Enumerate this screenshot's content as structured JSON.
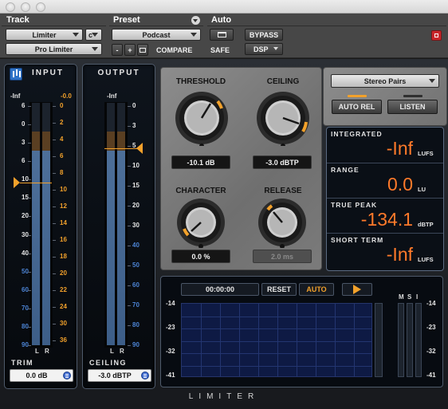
{
  "header": {
    "track_label": "Track",
    "preset_label": "Preset",
    "auto_label": "Auto",
    "track_select": "Limiter",
    "channel_select": "c",
    "plugin_select": "Pro Limiter",
    "preset_select": "Podcast",
    "minus": "-",
    "plus": "+",
    "compare": "COMPARE",
    "safe": "SAFE",
    "bypass": "BYPASS",
    "dsp": "DSP"
  },
  "input_meter": {
    "title": "INPUT",
    "peak_left": "-Inf",
    "peak_right": "-0.0",
    "left_scale": [
      "6",
      "0",
      "3",
      "6",
      "10",
      "15",
      "20",
      "30",
      "40",
      "50",
      "60",
      "70",
      "80",
      "90"
    ],
    "right_scale": [
      "0",
      "2",
      "4",
      "6",
      "8",
      "10",
      "12",
      "14",
      "16",
      "18",
      "20",
      "22",
      "24",
      "30",
      "36"
    ],
    "ch_left": "L",
    "ch_right": "R",
    "trim_label": "TRIM",
    "trim_value": "0.0 dB",
    "level_left": 0.88,
    "level_right": 0.88
  },
  "output_meter": {
    "title": "OUTPUT",
    "peak_left": "-Inf",
    "scale": [
      "0",
      "3",
      "5",
      "10",
      "15",
      "20",
      "30",
      "40",
      "50",
      "60",
      "70",
      "80",
      "90"
    ],
    "ch_left": "L",
    "ch_right": "R",
    "ceiling_label": "CEILING",
    "ceiling_value": "-3.0 dBTP",
    "level_left": 0.88,
    "level_right": 0.88
  },
  "knobs": {
    "threshold": {
      "label": "THRESHOLD",
      "value": "-10.1 dB"
    },
    "ceiling": {
      "label": "CEILING",
      "value": "-3.0 dBTP"
    },
    "character": {
      "label": "CHARACTER",
      "value": "0.0 %"
    },
    "release": {
      "label": "RELEASE",
      "value": "2.0 ms"
    }
  },
  "controls": {
    "mode_select": "Stereo Pairs",
    "auto_rel": "AUTO REL",
    "listen": "LISTEN"
  },
  "loudness": {
    "integrated": {
      "label": "INTEGRATED",
      "value": "-Inf",
      "unit": "LUFS"
    },
    "range": {
      "label": "RANGE",
      "value": "0.0",
      "unit": "LU"
    },
    "true_peak": {
      "label": "TRUE PEAK",
      "value": "-134.1",
      "unit": "dBTP"
    },
    "short_term": {
      "label": "SHORT TERM",
      "value": "-Inf",
      "unit": "LUFS"
    }
  },
  "history": {
    "time": "00:00:00",
    "reset": "RESET",
    "auto": "AUTO",
    "left_scale": [
      "-14",
      "-23",
      "-32",
      "-41"
    ],
    "right_scale": [
      "-14",
      "-23",
      "-32",
      "-41"
    ],
    "msi": [
      "M",
      "S",
      "I"
    ]
  },
  "brand": "LIMITER",
  "colors": {
    "accent": "#f2a12b",
    "readout": "#ff7a2a",
    "meter_fill": "#4d6f99"
  }
}
